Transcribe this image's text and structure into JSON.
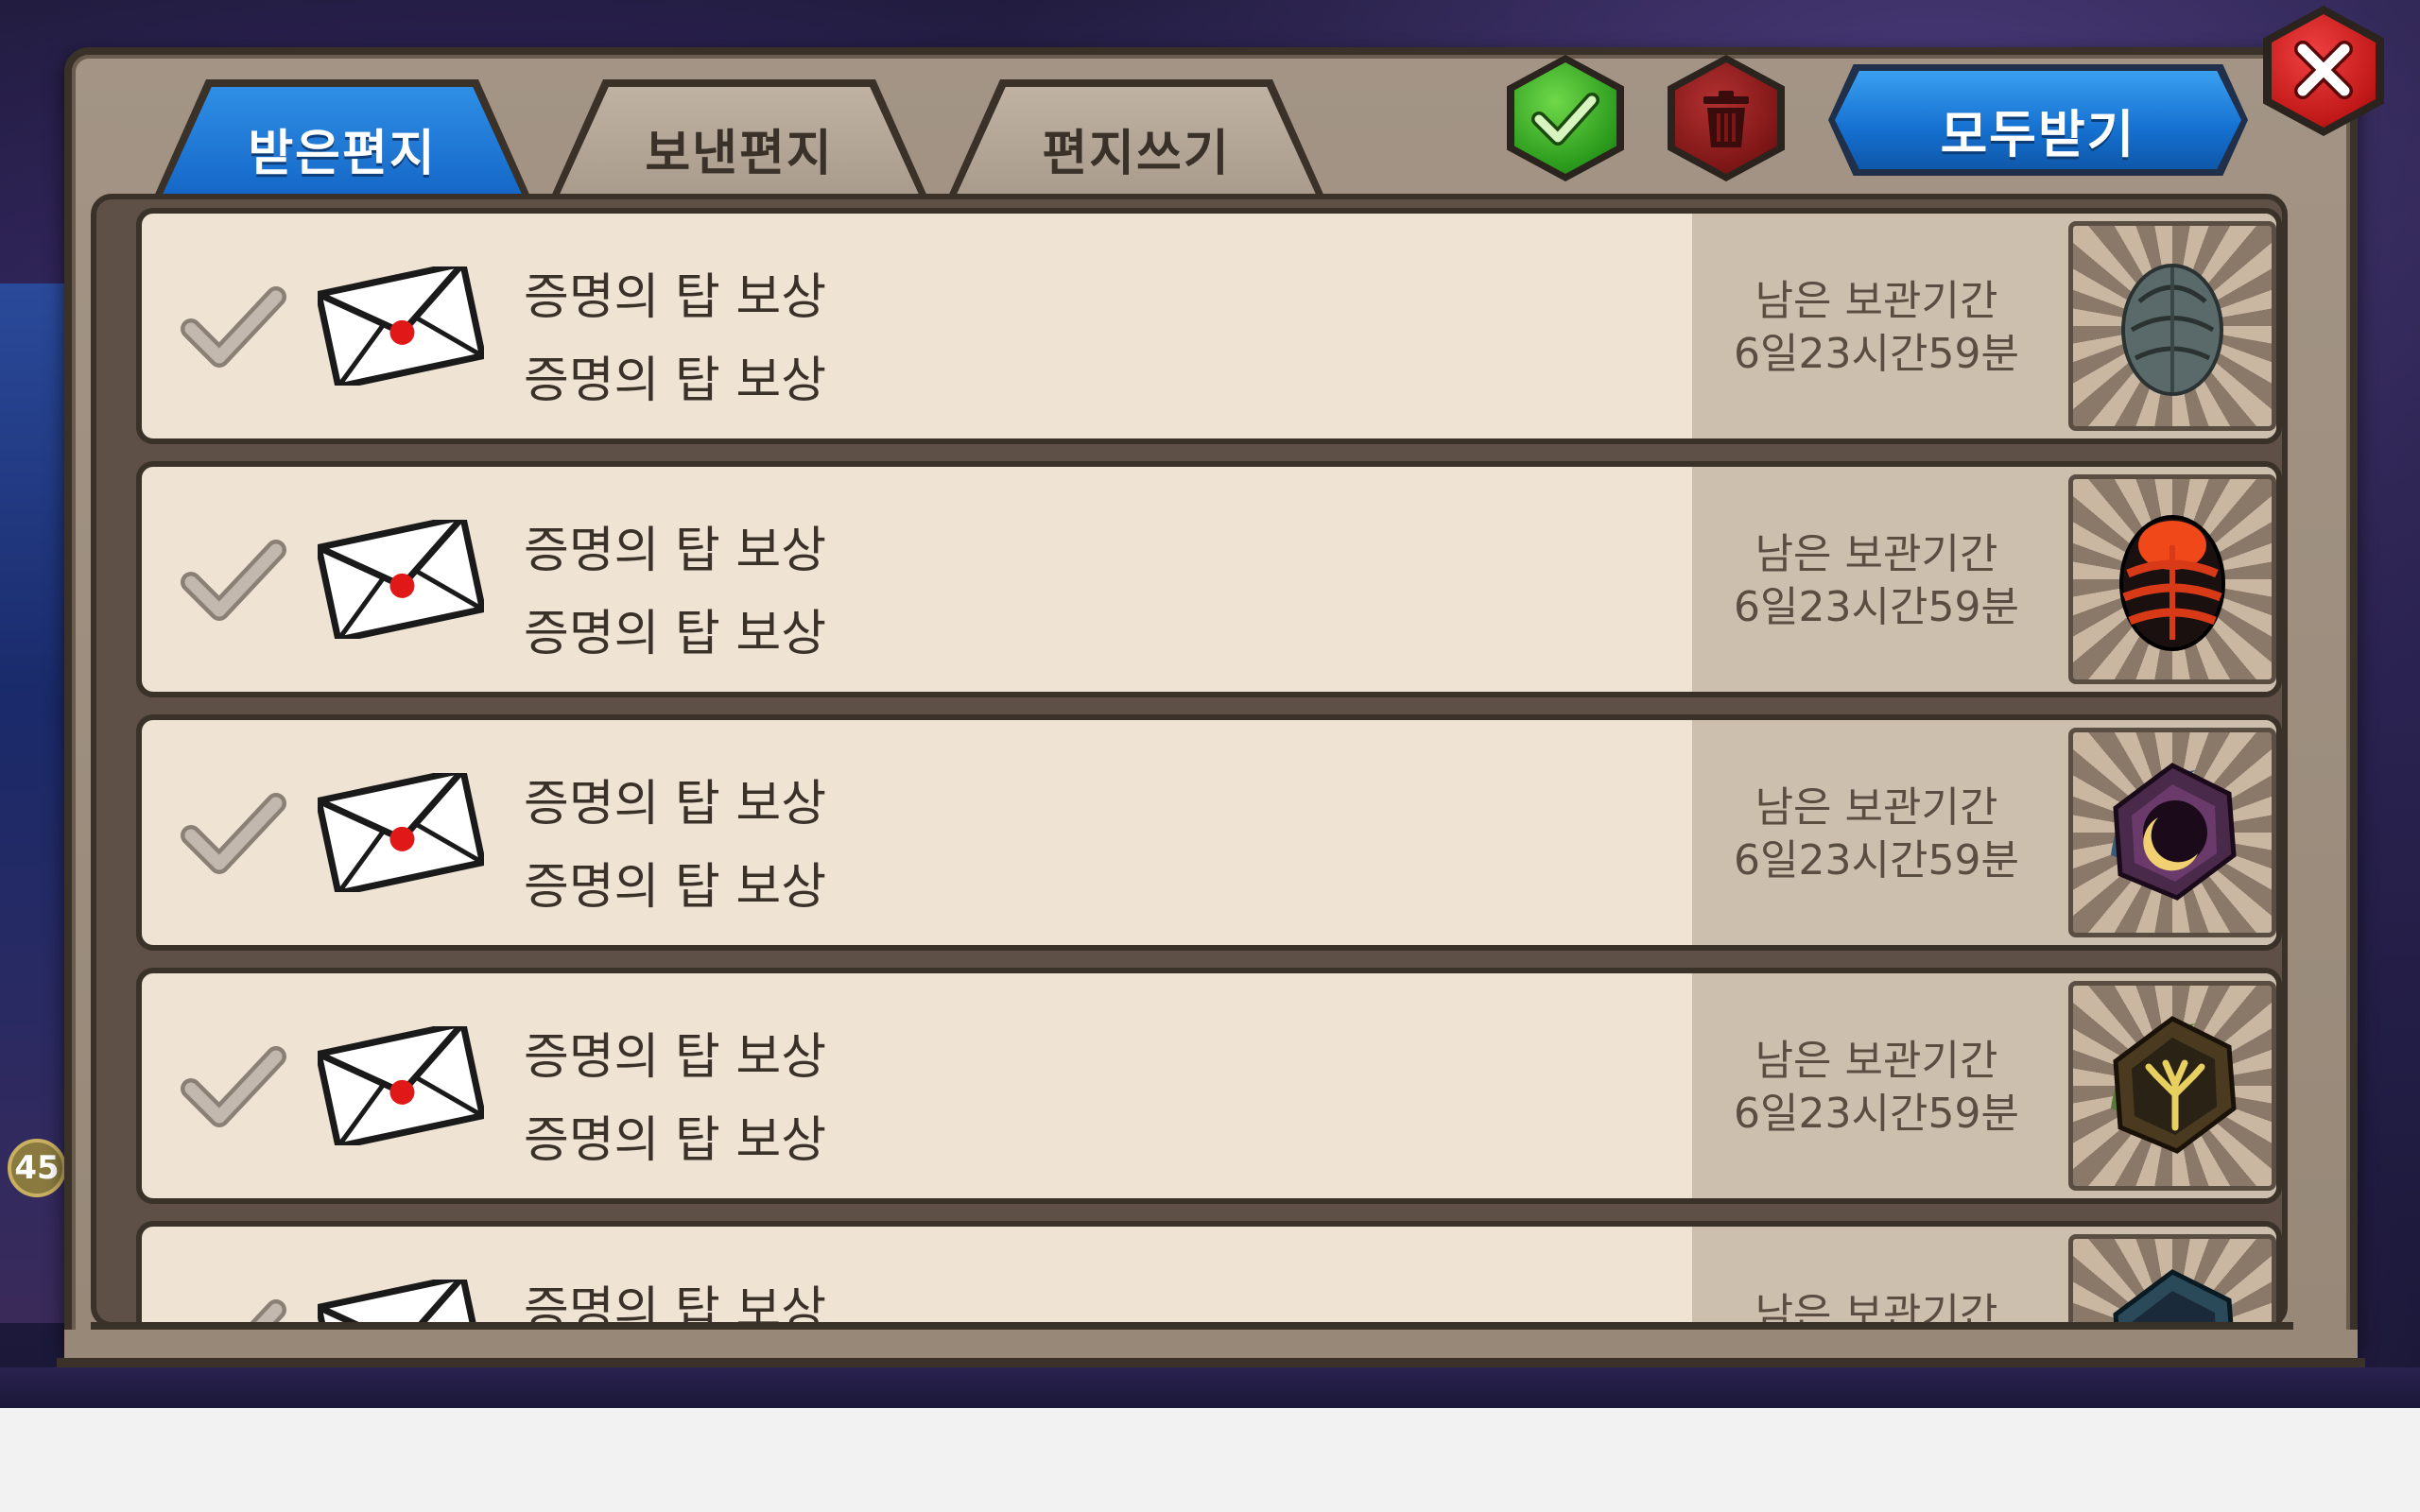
{
  "tabs": [
    {
      "label": "받은편지",
      "active": true
    },
    {
      "label": "보낸편지",
      "active": false
    },
    {
      "label": "편지쓰기",
      "active": false
    }
  ],
  "toolbar": {
    "confirm_icon": "check-icon",
    "delete_icon": "trash-icon",
    "receive_all_label": "모두받기",
    "close_icon": "close-icon"
  },
  "background": {
    "badge_text": "45"
  },
  "mails": [
    {
      "title": "증명의 탑 보상",
      "subtitle": "증명의 탑 보상",
      "remaining_label": "남은 보관기간",
      "remaining_time": "6일23시간59분",
      "item": "gray-egg"
    },
    {
      "title": "증명의 탑 보상",
      "subtitle": "증명의 탑 보상",
      "remaining_label": "남은 보관기간",
      "remaining_time": "6일23시간59분",
      "item": "red-egg"
    },
    {
      "title": "증명의 탑 보상",
      "subtitle": "증명의 탑 보상",
      "remaining_label": "남은 보관기간",
      "remaining_time": "6일23시간59분",
      "item": "moon-rune"
    },
    {
      "title": "증명의 탑 보상",
      "subtitle": "증명의 탑 보상",
      "remaining_label": "남은 보관기간",
      "remaining_time": "6일23시간59분",
      "item": "tree-rune"
    },
    {
      "title": "증명의 탑 보상",
      "subtitle": "",
      "remaining_label": "남은 보관기간",
      "remaining_time": "",
      "item": "water-rune"
    }
  ],
  "colors": {
    "tab_active": "#1466c6",
    "confirm_green": "#2a9a1c",
    "delete_red": "#7e1616",
    "close_red": "#c01818",
    "row_bg": "#efe4d4"
  }
}
